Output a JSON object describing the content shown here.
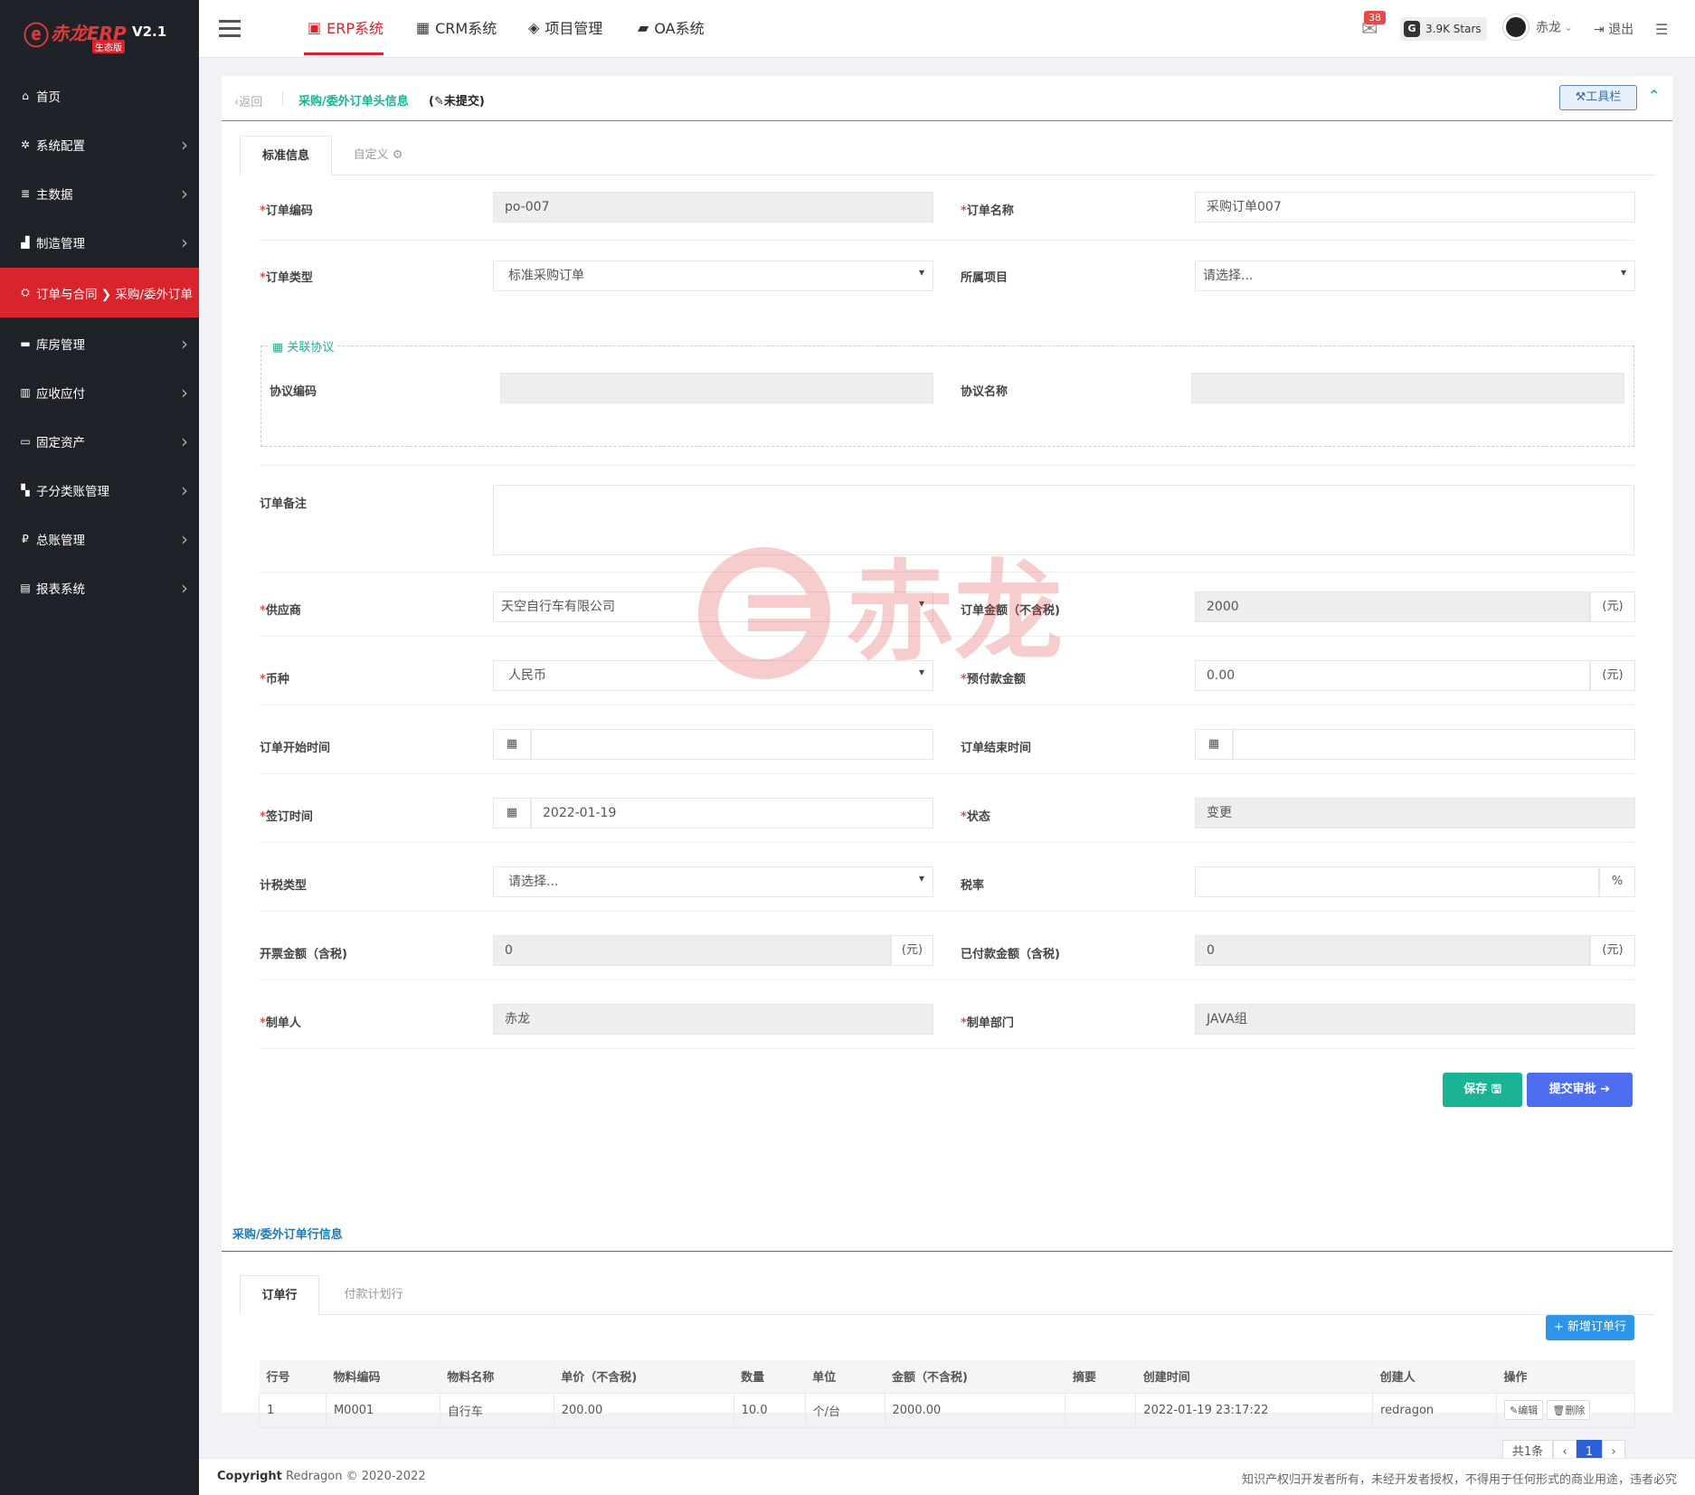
{
  "app": {
    "logo_mark": "ⓔ",
    "logo_brand": "赤龙ERP",
    "version": "V2.1",
    "edition": "生态版"
  },
  "sidebar": {
    "items": [
      {
        "label": "首页",
        "icon": "home-icon",
        "glyph": "⌂"
      },
      {
        "label": "系统配置",
        "icon": "gear-icon",
        "glyph": "✲"
      },
      {
        "label": "主数据",
        "icon": "database-icon",
        "glyph": "≣"
      },
      {
        "label": "制造管理",
        "icon": "bar-chart-icon",
        "glyph": "▟"
      },
      {
        "label": "订单与合同 ❯ 采购/委外订单",
        "icon": "handshake-icon",
        "glyph": "⛭"
      },
      {
        "label": "库房管理",
        "icon": "truck-icon",
        "glyph": "▬"
      },
      {
        "label": "应收应付",
        "icon": "bank-icon",
        "glyph": "▥"
      },
      {
        "label": "固定资产",
        "icon": "monitor-icon",
        "glyph": "▭"
      },
      {
        "label": "子分类账管理",
        "icon": "sitemap-icon",
        "glyph": "▚"
      },
      {
        "label": "总账管理",
        "icon": "ruble-icon",
        "glyph": "₽"
      },
      {
        "label": "报表系统",
        "icon": "book-icon",
        "glyph": "▤"
      }
    ]
  },
  "topnav": {
    "items": [
      {
        "label": "ERP系统",
        "icon": "erp-icon",
        "glyph": "▣"
      },
      {
        "label": "CRM系统",
        "icon": "crm-icon",
        "glyph": "▦"
      },
      {
        "label": "项目管理",
        "icon": "cube-icon",
        "glyph": "◈"
      },
      {
        "label": "OA系统",
        "icon": "cup-icon",
        "glyph": "▰"
      }
    ],
    "mail_badge": "38",
    "stars": "3.9K Stars",
    "stars_glyph": "G",
    "user": "赤龙",
    "user_caret": "⌄",
    "logout": "退出"
  },
  "panel": {
    "back": "返回",
    "back_glyph": "‹",
    "title": "采购/委外订单头信息",
    "state": "(✎未提交)",
    "toolbar": "工具栏",
    "toolbar_glyph": "⚒",
    "collapse_glyph": "⌃"
  },
  "tabs": {
    "standard": "标准信息",
    "custom": "自定义 ⚙"
  },
  "form": {
    "order_code": {
      "label": "订单编码",
      "value": "po-007"
    },
    "order_name": {
      "label": "订单名称",
      "value": "采购订单007"
    },
    "order_type": {
      "label": "订单类型",
      "value": "标准采购订单"
    },
    "project": {
      "label": "所属项目",
      "value": "请选择..."
    },
    "agreement_legend": "关联协议",
    "agreement_code": {
      "label": "协议编码",
      "value": ""
    },
    "agreement_name": {
      "label": "协议名称",
      "value": ""
    },
    "remark": {
      "label": "订单备注",
      "value": ""
    },
    "supplier": {
      "label": "供应商",
      "value": "天空自行车有限公司"
    },
    "amount": {
      "label": "订单金额（不含税)",
      "value": "2000",
      "unit": "(元)"
    },
    "currency": {
      "label": "币种",
      "value": "人民币"
    },
    "prepay": {
      "label": "预付款金额",
      "value": "0.00",
      "unit": "(元)"
    },
    "start_date": {
      "label": "订单开始时间",
      "value": ""
    },
    "end_date": {
      "label": "订单结束时间",
      "value": ""
    },
    "sign_date": {
      "label": "签订时间",
      "value": "2022-01-19"
    },
    "status": {
      "label": "状态",
      "value": "变更"
    },
    "tax_type": {
      "label": "计税类型",
      "value": "请选择..."
    },
    "tax_rate": {
      "label": "税率",
      "value": "",
      "unit": "%"
    },
    "invoice_amount": {
      "label": "开票金额（含税)",
      "value": "0",
      "unit": "(元)"
    },
    "paid_amount": {
      "label": "已付款金额（含税)",
      "value": "0",
      "unit": "(元)"
    },
    "creator": {
      "label": "制单人",
      "value": "赤龙"
    },
    "department": {
      "label": "制单部门",
      "value": "JAVA组"
    },
    "req": "*",
    "save": "保存 🖫",
    "submit": "提交审批 ➔"
  },
  "lines": {
    "section_title": "采购/委外订单行信息",
    "tab_lines": "订单行",
    "tab_payment": "付款计划行",
    "add": "+ 新增订单行",
    "columns": [
      "行号",
      "物料编码",
      "物料名称",
      "单价（不含税)",
      "数量",
      "单位",
      "金额（不含税)",
      "摘要",
      "创建时间",
      "创建人",
      "操作"
    ],
    "rows": [
      [
        "1",
        "M0001",
        "自行车",
        "200.00",
        "10.0",
        "个/台",
        "2000.00",
        "",
        "2022-01-19 23:17:22",
        "redragon"
      ]
    ],
    "edit": "✎编辑",
    "delete": "🗑删除",
    "total": "共1条",
    "prev": "‹",
    "page": "1",
    "next": "›"
  },
  "footer": {
    "copyright": "Copyright",
    "owner": "Redragon © 2020-2022",
    "notice": "知识产权归开发者所有，未经开发者授权，不得用于任何形式的商业用途，违者必究"
  },
  "watermark": "赤龙",
  "colors": {
    "brand_red": "#d9232d",
    "green": "#1ab394",
    "blue": "#1a7bb9",
    "submit": "#4e6ef2"
  }
}
